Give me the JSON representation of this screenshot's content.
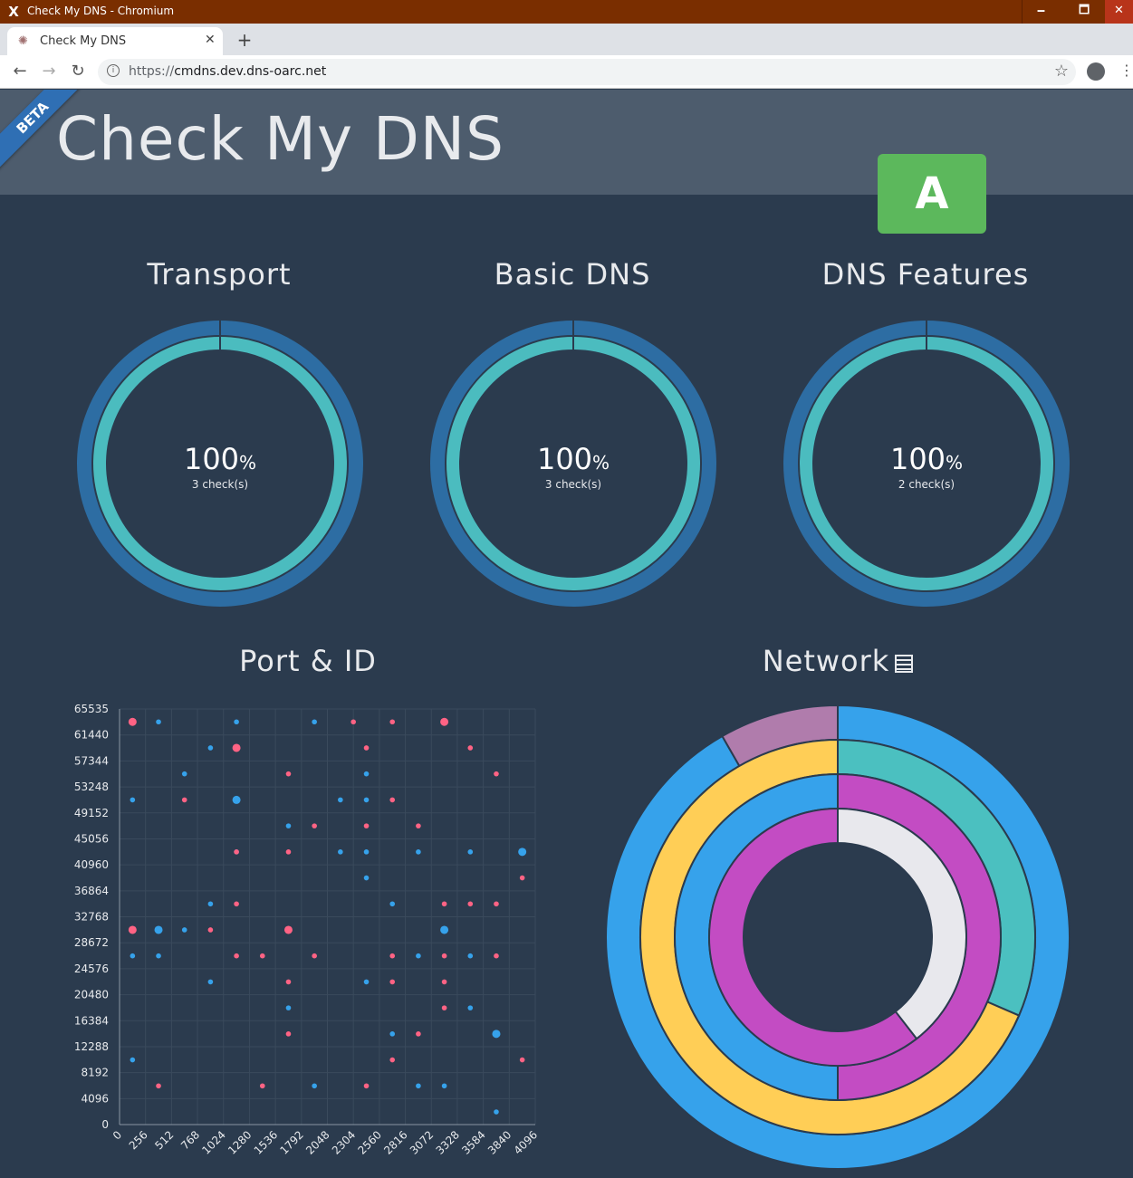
{
  "window": {
    "title": "Check My DNS - Chromium",
    "min": "🗕",
    "max": "🗖",
    "close": "✕"
  },
  "tab": {
    "label": "Check My DNS",
    "close": "✕",
    "new_tab": "+"
  },
  "toolbar": {
    "back": "←",
    "forward": "→",
    "reload": "↻",
    "url_scheme": "https://",
    "url_host": "cmdns.dev.dns-oarc.net",
    "star": "☆",
    "menu": "⋮"
  },
  "page": {
    "title": "Check My DNS",
    "ribbon": "BETA",
    "grade": "A"
  },
  "gauges": [
    {
      "title": "Transport",
      "percent": "100",
      "unit": "%",
      "checks": "3 check(s)",
      "value": 1.0
    },
    {
      "title": "Basic DNS",
      "percent": "100",
      "unit": "%",
      "checks": "3 check(s)",
      "value": 1.0
    },
    {
      "title": "DNS Features",
      "percent": "100",
      "unit": "%",
      "checks": "2 check(s)",
      "value": 1.0
    }
  ],
  "port_id": {
    "title": "Port & ID"
  },
  "network": {
    "title": "Network",
    "icon": "list-icon"
  },
  "colors": {
    "outer_ring": "#2d6da3",
    "inner_ring": "#4bbcbf",
    "blue": "#36a2eb",
    "pink": "#ff6384",
    "yellow": "#ffce56",
    "teal": "#4bc0c0",
    "magenta": "#c34cc3",
    "white": "#e8e8ed",
    "mauve": "#b07cac",
    "grade": "#5cb85c"
  },
  "chart_data": [
    {
      "type": "scatter",
      "title": "Port & ID",
      "xlim": [
        0,
        4096
      ],
      "ylim": [
        0,
        65535
      ],
      "x_ticks": [
        "0",
        "256",
        "512",
        "768",
        "1024",
        "1280",
        "1536",
        "1792",
        "2048",
        "2304",
        "2560",
        "2816",
        "3072",
        "3328",
        "3584",
        "3840",
        "4096"
      ],
      "y_ticks": [
        "0",
        "4096",
        "8192",
        "12288",
        "16384",
        "20480",
        "24576",
        "28672",
        "32768",
        "36864",
        "40960",
        "45056",
        "49152",
        "53248",
        "57344",
        "61440",
        "65535"
      ],
      "series": [
        {
          "color": "#36a2eb",
          "points": [
            [
              384,
              63500
            ],
            [
              1152,
              63500
            ],
            [
              1920,
              63500
            ],
            [
              896,
              59400
            ],
            [
              640,
              55300
            ],
            [
              2432,
              55300
            ],
            [
              128,
              51200
            ],
            [
              1152,
              51200,
              1
            ],
            [
              2176,
              51200
            ],
            [
              2432,
              51200
            ],
            [
              1664,
              47100
            ],
            [
              1152,
              43000
            ],
            [
              2176,
              43000
            ],
            [
              2432,
              43000
            ],
            [
              2944,
              43000
            ],
            [
              3456,
              43000
            ],
            [
              3968,
              43000,
              1
            ],
            [
              2432,
              38900
            ],
            [
              896,
              34800
            ],
            [
              2688,
              34800
            ],
            [
              384,
              30700,
              1
            ],
            [
              640,
              30700
            ],
            [
              3200,
              30700,
              1
            ],
            [
              128,
              26600
            ],
            [
              384,
              26600
            ],
            [
              2944,
              26600
            ],
            [
              3456,
              26600
            ],
            [
              896,
              22500
            ],
            [
              2432,
              22500
            ],
            [
              1664,
              18400
            ],
            [
              3456,
              18400
            ],
            [
              2688,
              14300
            ],
            [
              3712,
              14300,
              1
            ],
            [
              128,
              10200
            ],
            [
              1920,
              6100
            ],
            [
              2944,
              6100
            ],
            [
              3200,
              6100
            ],
            [
              3712,
              2000
            ]
          ]
        },
        {
          "color": "#ff6384",
          "points": [
            [
              128,
              63500,
              1
            ],
            [
              2304,
              63500
            ],
            [
              2688,
              63500
            ],
            [
              3200,
              63500,
              1
            ],
            [
              1152,
              59400,
              1
            ],
            [
              2432,
              59400
            ],
            [
              3456,
              59400
            ],
            [
              1664,
              55300
            ],
            [
              3712,
              55300
            ],
            [
              640,
              51200
            ],
            [
              2688,
              51200
            ],
            [
              1920,
              47100
            ],
            [
              2432,
              47100
            ],
            [
              2944,
              47100
            ],
            [
              1152,
              43000
            ],
            [
              1664,
              43000
            ],
            [
              3968,
              38900
            ],
            [
              1152,
              34800
            ],
            [
              3200,
              34800
            ],
            [
              3456,
              34800
            ],
            [
              3712,
              34800
            ],
            [
              128,
              30700,
              1
            ],
            [
              896,
              30700
            ],
            [
              1664,
              30700,
              1
            ],
            [
              1152,
              26600
            ],
            [
              1408,
              26600
            ],
            [
              1920,
              26600
            ],
            [
              2688,
              26600
            ],
            [
              3200,
              26600
            ],
            [
              3712,
              26600
            ],
            [
              1664,
              22500
            ],
            [
              2688,
              22500
            ],
            [
              3200,
              22500
            ],
            [
              3200,
              18400
            ],
            [
              1664,
              14300
            ],
            [
              2944,
              14300
            ],
            [
              2688,
              10200
            ],
            [
              3968,
              10200
            ],
            [
              384,
              6100
            ],
            [
              1408,
              6100
            ],
            [
              2432,
              6100
            ]
          ]
        }
      ]
    },
    {
      "type": "pie",
      "title": "Network",
      "rings": [
        {
          "values": [
            0.917,
            0.083
          ],
          "colors": [
            "#36a2eb",
            "#b07cac"
          ]
        },
        {
          "values": [
            0.315,
            0.685
          ],
          "colors": [
            "#4bc0c0",
            "#ffce56"
          ]
        },
        {
          "values": [
            0.5,
            0.5
          ],
          "colors": [
            "#c34cc3",
            "#36a2eb"
          ]
        },
        {
          "values": [
            0.395,
            0.605
          ],
          "colors": [
            "#e8e8ed",
            "#c34cc3"
          ]
        }
      ]
    }
  ]
}
